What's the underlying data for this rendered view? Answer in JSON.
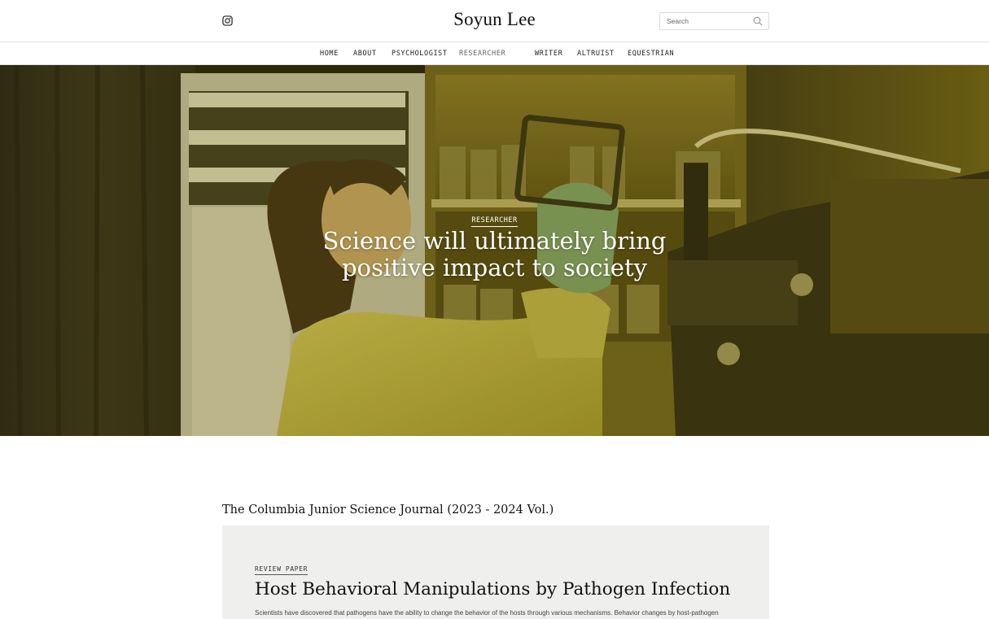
{
  "header": {
    "site_title": "Soyun Lee",
    "search_placeholder": "Search",
    "social_icon": "instagram-icon",
    "search_icon": "search-icon"
  },
  "nav": {
    "items": [
      {
        "label": "HOME",
        "active": false
      },
      {
        "label": "ABOUT",
        "active": false
      },
      {
        "label": "PSYCHOLOGIST",
        "active": false
      },
      {
        "label": "RESEARCHER",
        "active": true
      },
      {
        "label": "WRITER",
        "active": false
      },
      {
        "label": "ALTRUIST",
        "active": false
      },
      {
        "label": "EQUESTRIAN",
        "active": false
      }
    ]
  },
  "hero": {
    "category": "RESEARCHER",
    "headline_line1": "Science will ultimately bring",
    "headline_line2": "positive impact to society",
    "image_description_hidden": ""
  },
  "content": {
    "journal_heading": "The Columbia Junior Science Journal (2023 - 2024 Vol.)",
    "card": {
      "tag": "REVIEW PAPER",
      "title": "Host Behavioral Manipulations by Pathogen Infection",
      "excerpt": "Scientists have discovered that pathogens have the ability to change the behavior of the hosts through various mechanisms. Behavior changes by host-pathogen"
    }
  },
  "colors": {
    "hero_tint": "#8a7a10",
    "card_background": "#efefed",
    "border": "#e4e4e4"
  }
}
